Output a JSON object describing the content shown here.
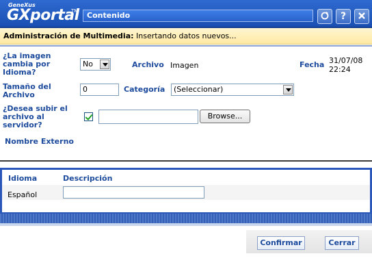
{
  "header": {
    "brand_small": "GeneXus",
    "brand_name": "GXportal",
    "brand_tm": "TM",
    "title": "Contenido",
    "buttons": [
      {
        "icon": "refresh-icon"
      },
      {
        "label": "?",
        "icon": "help-icon"
      },
      {
        "icon": "close-icon"
      }
    ]
  },
  "info_bar": {
    "heading": "Administración de Multimedia:",
    "message": "Insertando datos nuevos..."
  },
  "form": {
    "image_changes_label": "¿La imagen cambia por Idioma?",
    "image_changes_value": "No",
    "file_label": "Archivo",
    "file_value": "Imagen",
    "date_label": "Fecha",
    "date_value": "31/07/08 22:24",
    "size_label": "Tamaño del Archivo",
    "size_value": "0",
    "category_label": "Categoría",
    "category_value": "(Seleccionar)",
    "upload_label": "¿Desea subir el archivo al servidor?",
    "upload_checked": true,
    "upload_path": "",
    "browse_label": "Browse...",
    "external_name_label": "Nombre Externo"
  },
  "grid": {
    "columns": [
      "Idioma",
      "Descripción"
    ],
    "rows": [
      {
        "idioma": "Español",
        "descripcion": ""
      }
    ]
  },
  "actions": {
    "confirm_label": "Confirmar",
    "close_label": "Cerrar"
  },
  "colors": {
    "header_blue": "#1a4fb2",
    "label_blue": "#1c4a9c",
    "info_yellow": "#ffe9a2"
  }
}
